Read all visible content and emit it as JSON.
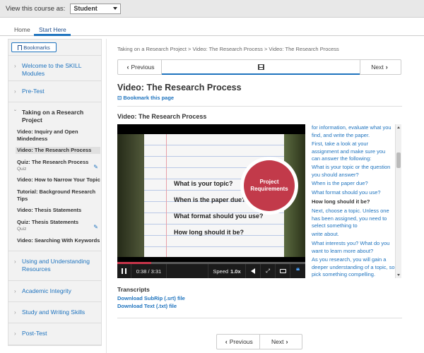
{
  "topbar": {
    "view_label": "View this course as:",
    "role_value": "Student"
  },
  "tabs": [
    {
      "label": "Home"
    },
    {
      "label": "Start Here"
    }
  ],
  "sidebar": {
    "bookmarks_label": "Bookmarks",
    "sections": [
      {
        "label": "Welcome to the SKILL Modules",
        "expanded": false
      },
      {
        "label": "Pre-Test",
        "expanded": false
      },
      {
        "label": "Taking on a Research Project",
        "expanded": true,
        "items": [
          {
            "label": "Video: Inquiry and Open Mindedness"
          },
          {
            "label": "Video: The Research Process",
            "active": true
          },
          {
            "label": "Quiz: The Research Process",
            "type": "Quiz"
          },
          {
            "label": "Video: How to Narrow Your Topic"
          },
          {
            "label": "Tutorial: Background Research Tips"
          },
          {
            "label": "Video: Thesis Statements"
          },
          {
            "label": "Quiz: Thesis Statements",
            "type": "Quiz"
          },
          {
            "label": "Video: Searching With Keywords"
          }
        ]
      },
      {
        "label": "Using and Understanding Resources",
        "expanded": false
      },
      {
        "label": "Academic Integrity",
        "expanded": false
      },
      {
        "label": "Study and Writing Skills",
        "expanded": false
      },
      {
        "label": "Post-Test",
        "expanded": false
      }
    ]
  },
  "main": {
    "breadcrumb": "Taking on a Research Project > Video: The Research Process > Video: The Research Process",
    "nav": {
      "previous": "Previous",
      "next": "Next"
    },
    "title": "Video: The Research Process",
    "bookmark_link": "Bookmark this page",
    "section_title": "Video: The Research Process",
    "video": {
      "questions": [
        "What is your topic?",
        "When is the paper due?",
        "What format should you use?",
        "How long should it be?"
      ],
      "badge_line1": "Project",
      "badge_line2": "Requirements",
      "time": "0:38 / 3:31",
      "progress": 0.18,
      "speed_label": "Speed",
      "speed_value": "1.0x"
    },
    "transcript_lines": [
      {
        "text": "for information, evaluate what you find, and write the paper."
      },
      {
        "text": "First, take a look at your assignment and make sure you can answer the following:"
      },
      {
        "text": "What is your topic or the question you should answer?"
      },
      {
        "text": "When is the paper due?"
      },
      {
        "text": "What format should you use?"
      },
      {
        "text": "How long should it be?",
        "current": true
      },
      {
        "text": "Next, choose a topic. Unless one has been assigned, you need to select something to"
      },
      {
        "text": "write about."
      },
      {
        "text": "What interests you? What do you want to learn more about?"
      },
      {
        "text": "As you research, you will gain a deeper understanding of a topic, so pick something compelling."
      }
    ],
    "transcripts_heading": "Transcripts",
    "downloads": [
      "Download SubRip (.srt) file",
      "Download Text (.txt) file"
    ],
    "pager": {
      "previous": "Previous",
      "next": "Next"
    }
  },
  "colors": {
    "accent": "#1e73be",
    "badge": "#c23a4a",
    "progress": "#c8354a"
  },
  "icons": {
    "bookmark": "bookmark-icon",
    "film": "film-icon",
    "play": "pause-icon",
    "volume": "volume-icon",
    "fullscreen": "fullscreen-icon",
    "cc": "closed-captions-icon",
    "transcript": "transcript-toggle-icon",
    "edit": "edit-icon"
  }
}
